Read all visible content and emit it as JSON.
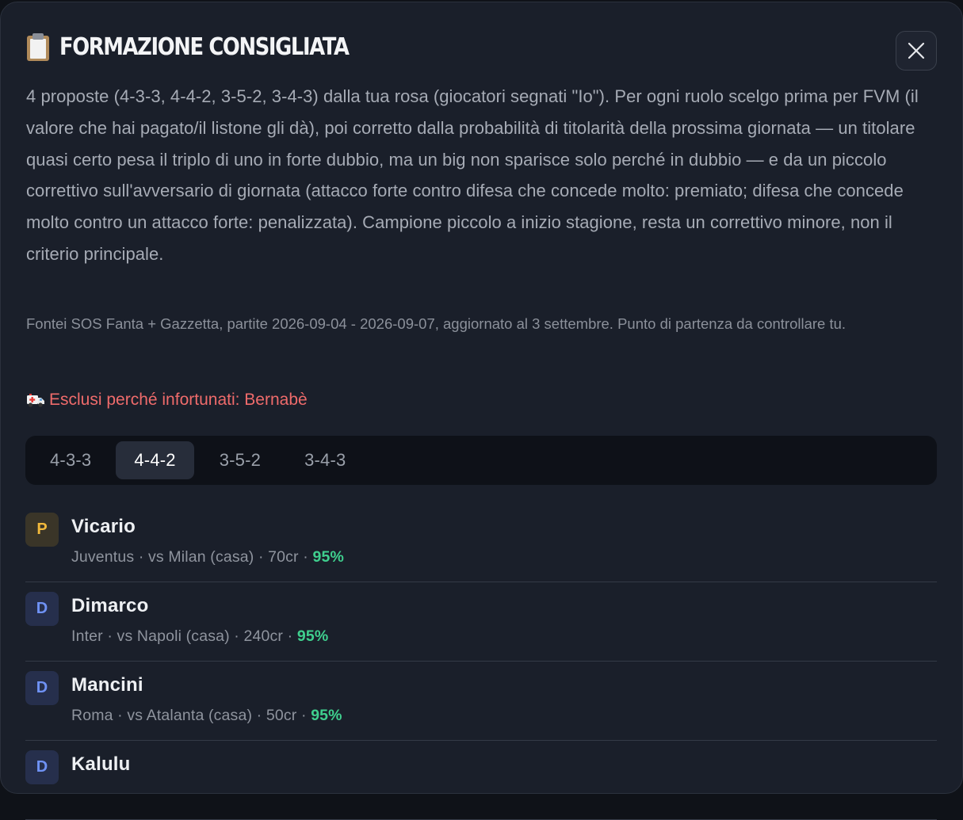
{
  "modal": {
    "title": "FORMAZIONE CONSIGLIATA",
    "title_icon": "clipboard-icon",
    "close_icon": "close-icon",
    "intro": "4 proposte (4-3-3, 4-4-2, 3-5-2, 3-4-3) dalla tua rosa (giocatori segnati \"Io\"). Per ogni ruolo scelgo prima per FVM (il valore che hai pagato/il listone gli dà), poi corretto dalla probabilità di titolarità della prossima giornata — un titolare quasi certo pesa il triplo di uno in forte dubbio, ma un big non sparisce solo perché in dubbio — e da un piccolo correttivo sull'avversario di giornata (attacco forte contro difesa che concede molto: premiato; difesa che concede molto contro un attacco forte: penalizzata). Campione piccolo a inizio stagione, resta un correttivo minore, non il criterio principale.",
    "sources": "Fontei SOS Fanta + Gazzetta, partite 2026-09-04 - 2026-09-07, aggiornato al 3 settembre. Punto di partenza da controllare tu.",
    "injured_icon": "ambulance-icon",
    "injured": "Esclusi perché infortunati: Bernabè"
  },
  "tabs": [
    {
      "label": "4-3-3",
      "active": false
    },
    {
      "label": "4-4-2",
      "active": true
    },
    {
      "label": "3-5-2",
      "active": false
    },
    {
      "label": "3-4-3",
      "active": false
    }
  ],
  "players": [
    {
      "role": "P",
      "name": "Vicario",
      "info": "Juventus · vs Milan (casa) · 70cr · ",
      "pct": "95%"
    },
    {
      "role": "D",
      "name": "Dimarco",
      "info": "Inter · vs Napoli (casa) · 240cr · ",
      "pct": "95%"
    },
    {
      "role": "D",
      "name": "Mancini",
      "info": "Roma · vs Atalanta (casa) · 50cr · ",
      "pct": "95%"
    },
    {
      "role": "D",
      "name": "Kalulu",
      "info": "",
      "pct": ""
    }
  ],
  "colors": {
    "background": "#1a1f2a",
    "injured_text": "#ef6b6b",
    "probability": "#3fcf8e",
    "goalkeeper_badge": "#f2b93b",
    "defender_badge": "#6f92f5"
  }
}
